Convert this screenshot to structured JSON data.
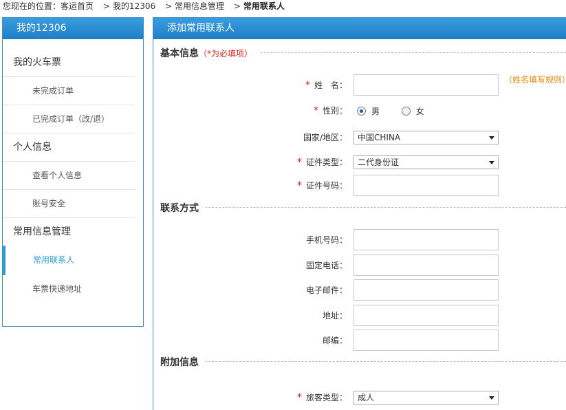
{
  "breadcrumb": {
    "prefix": "您现在的位置：",
    "items": [
      "客运首页",
      "我的12306",
      "常用信息管理",
      "常用联系人"
    ],
    "separator": ">"
  },
  "sidebar": {
    "title": "我的12306",
    "groups": [
      {
        "label": "我的火车票",
        "items": [
          "未完成订单",
          "已完成订单（改/退）"
        ]
      },
      {
        "label": "个人信息",
        "items": [
          "查看个人信息",
          "账号安全"
        ]
      },
      {
        "label": "常用信息管理",
        "items": [
          "常用联系人",
          "车票快递地址"
        ]
      }
    ],
    "active_item": "常用联系人"
  },
  "main": {
    "title": "添加常用联系人",
    "sections": {
      "basic": {
        "title": "基本信息",
        "note": "（*为必填项）"
      },
      "contact": {
        "title": "联系方式"
      },
      "extra": {
        "title": "附加信息"
      }
    },
    "fields": {
      "name": {
        "label": "姓　名：",
        "value": "",
        "placeholder": "",
        "hint": "（姓名填写规则）"
      },
      "gender": {
        "label": "性别：",
        "options": [
          "男",
          "女"
        ],
        "selected": "男"
      },
      "country": {
        "label": "国家/地区：",
        "value": "中国CHINA"
      },
      "id_type": {
        "label": "证件类型：",
        "value": "二代身份证"
      },
      "id_number": {
        "label": "证件号码：",
        "value": ""
      },
      "mobile": {
        "label": "手机号码：",
        "value": ""
      },
      "phone": {
        "label": "固定电话：",
        "value": ""
      },
      "email": {
        "label": "电子邮件：",
        "value": ""
      },
      "address": {
        "label": "地址：",
        "value": ""
      },
      "zip": {
        "label": "邮编：",
        "value": ""
      },
      "passenger_type": {
        "label": "旅客类型：",
        "value": "成人"
      }
    },
    "required_mark": "*"
  },
  "colors": {
    "accent": "#2c9fd8",
    "header": "#1f7fc4",
    "required": "#e2231a",
    "hint": "#f08300"
  }
}
